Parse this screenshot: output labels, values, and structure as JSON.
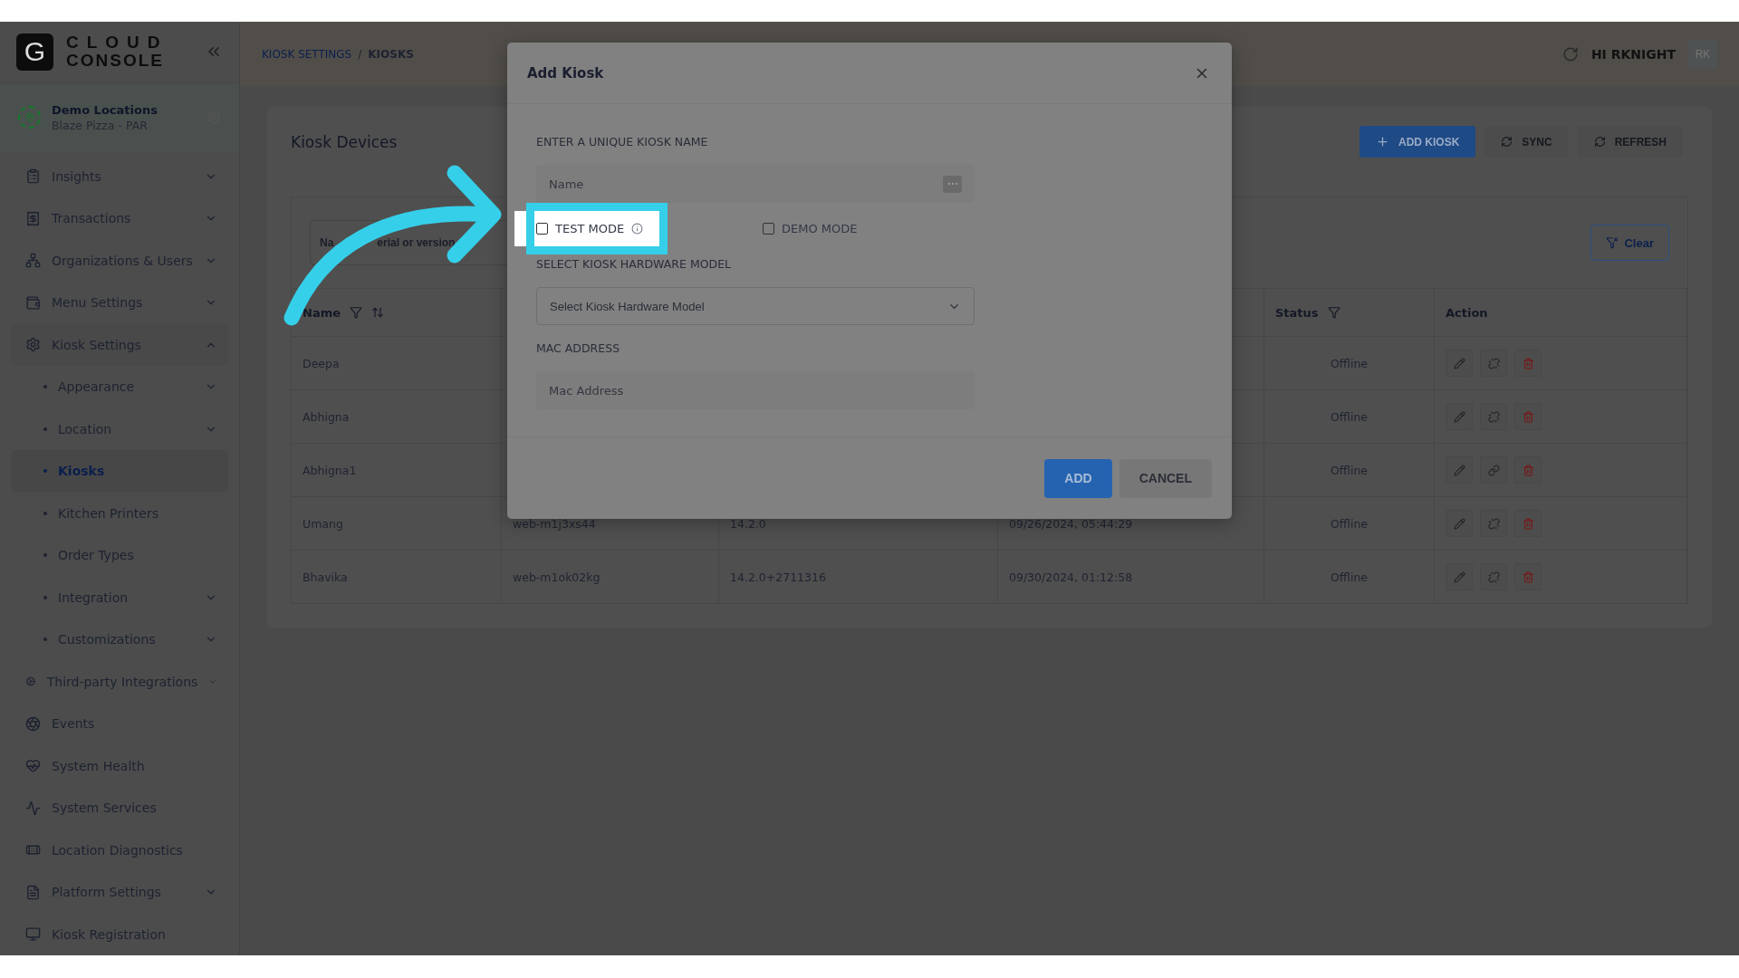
{
  "logo": {
    "mark": "G",
    "line1": "CLOUD",
    "line2": "CONSOLE"
  },
  "location": {
    "name": "Demo Locations",
    "subtitle": "Blaze Pizza - PAR"
  },
  "sidebar": {
    "items": [
      {
        "label": "Insights",
        "expandable": true,
        "expanded": false,
        "selected": false
      },
      {
        "label": "Transactions",
        "expandable": true,
        "expanded": false,
        "selected": false
      },
      {
        "label": "Organizations & Users",
        "expandable": true,
        "expanded": false,
        "selected": false
      },
      {
        "label": "Menu Settings",
        "expandable": true,
        "expanded": false,
        "selected": false
      },
      {
        "label": "Kiosk Settings",
        "expandable": true,
        "expanded": true,
        "selected": false,
        "children": [
          {
            "label": "Appearance",
            "expandable": true,
            "selected": false
          },
          {
            "label": "Location",
            "expandable": true,
            "selected": false
          },
          {
            "label": "Kiosks",
            "expandable": false,
            "selected": true
          },
          {
            "label": "Kitchen Printers",
            "expandable": false,
            "selected": false
          },
          {
            "label": "Order Types",
            "expandable": false,
            "selected": false
          },
          {
            "label": "Integration",
            "expandable": true,
            "selected": false
          },
          {
            "label": "Customizations",
            "expandable": true,
            "selected": false
          }
        ]
      },
      {
        "label": "Third-party Integrations",
        "expandable": true,
        "expanded": false,
        "selected": false
      },
      {
        "label": "Events",
        "expandable": false,
        "selected": false
      },
      {
        "label": "System Health",
        "expandable": false,
        "selected": false
      },
      {
        "label": "System Services",
        "expandable": false,
        "selected": false
      },
      {
        "label": "Location Diagnostics",
        "expandable": false,
        "selected": false
      },
      {
        "label": "Platform Settings",
        "expandable": true,
        "expanded": false,
        "selected": false
      },
      {
        "label": "Kiosk Registration",
        "expandable": false,
        "selected": false
      }
    ]
  },
  "breadcrumb": [
    "KIOSK SETTINGS",
    "KIOSKS"
  ],
  "breadcrumb_separator": "/",
  "user": {
    "greeting": "HI RKNIGHT",
    "initials": "RK"
  },
  "page": {
    "title": "Kiosk Devices",
    "buttons": [
      {
        "label": "ADD KIOSK",
        "kind": "primary"
      },
      {
        "label": "SYNC",
        "kind": "plain"
      },
      {
        "label": "REFRESH",
        "kind": "plain"
      }
    ]
  },
  "filter": {
    "search_value_parts": [
      "Na",
      "erial or version"
    ],
    "clear_label": "Clear"
  },
  "table": {
    "columns": [
      {
        "label": "Name",
        "filter": true,
        "sort": true,
        "kind": "name"
      },
      {
        "label": "Status",
        "filter": true,
        "sort": false,
        "kind": "status"
      },
      {
        "label": "Action",
        "filter": false,
        "sort": false,
        "kind": "action"
      }
    ],
    "rows": [
      {
        "name": "Deepa",
        "status": "Offline",
        "linked": false
      },
      {
        "name": "Abhigna",
        "status": "Offline",
        "linked": false
      },
      {
        "name": "Abhigna1",
        "status": "Offline",
        "linked": true
      },
      {
        "name": "Umang",
        "column_2": "web-m1j3xs44",
        "column_3": "14.2.0",
        "column_4": "09/26/2024, 05:44:29",
        "status": "Offline",
        "linked": false
      },
      {
        "name": "Bhavika",
        "column_2": "web-m1ok02kg",
        "column_3": "14.2.0+2711316",
        "column_4": "09/30/2024, 01:12:58",
        "status": "Offline",
        "linked": false
      }
    ]
  },
  "modal": {
    "title": "Add Kiosk",
    "name_label": "ENTER A UNIQUE KIOSK NAME",
    "name_placeholder": "Name",
    "checkboxes": [
      {
        "label": "TEST MODE",
        "checked": false,
        "info": true,
        "highlighted": true
      },
      {
        "label": "DEMO MODE",
        "checked": false,
        "info": false,
        "highlighted": false
      }
    ],
    "hardware_label": "SELECT KIOSK HARDWARE MODEL",
    "hardware_placeholder": "Select Kiosk Hardware Model",
    "mac_label": "MAC ADDRESS",
    "mac_placeholder": "Mac Address",
    "buttons": [
      {
        "label": "ADD",
        "kind": "primary"
      },
      {
        "label": "CANCEL",
        "kind": "plain"
      }
    ]
  }
}
